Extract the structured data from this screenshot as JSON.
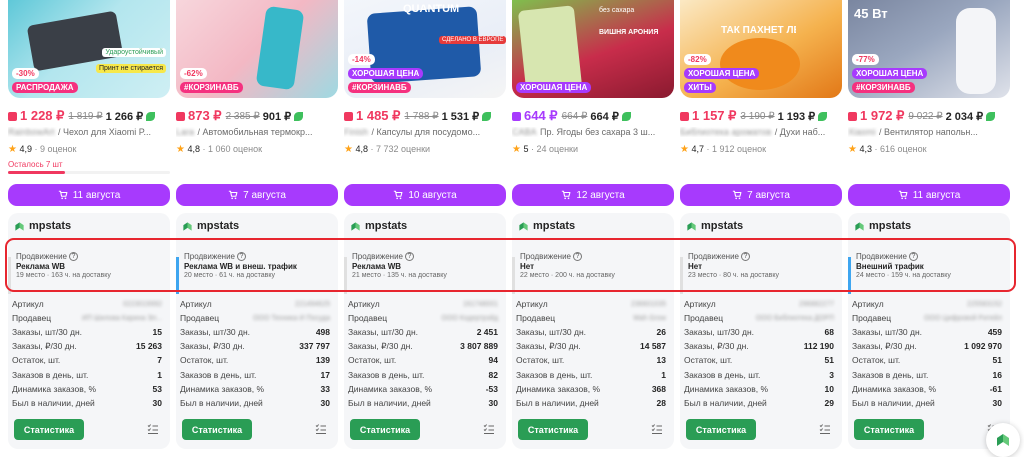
{
  "products": [
    {
      "image_badges": [
        "-30%",
        "РАСПРОДАЖА"
      ],
      "image_overlay": [
        "Удароустойчивый",
        "Принт не стирается"
      ],
      "price_now": "1 228 ₽",
      "price_old": "1 819 ₽",
      "price_wallet": "1 266 ₽",
      "brand": "RainbowArt",
      "title": "/ Чехол для Xiaomi P...",
      "rating": "4,9",
      "reviews": "· 9 оценок",
      "stock_left": "Осталось 7 шт",
      "delivery": "11 августа",
      "price_color": "#f0385f",
      "promo_label": "Продвижение",
      "promo_value": "Реклама WB",
      "promo_pos": "19 место · 163 ч. на доставку",
      "promo_bar_color": "#e0e0e0",
      "article": "0223019992",
      "seller": "ИП Шилова Карина Эл...",
      "stats": {
        "orders_qty": "15",
        "orders_rub": "15 263",
        "stock": "7",
        "orders_day": "1",
        "dyn": "53",
        "days": "30"
      }
    },
    {
      "image_badges": [
        "-62%",
        "#КОРЗИНАВБ"
      ],
      "image_overlay": [],
      "price_now": "873 ₽",
      "price_old": "2 385 ₽",
      "price_wallet": "901 ₽",
      "brand": "Lara",
      "title": "/ Автомобильная термокр...",
      "rating": "4,8",
      "reviews": "· 1 060 оценок",
      "stock_left": "",
      "delivery": "7 августа",
      "price_color": "#f0385f",
      "promo_label": "Продвижение",
      "promo_value": "Реклама WB и внеш. трафик",
      "promo_pos": "20 место · 61 ч. на доставку",
      "promo_bar_color": "#3fa6f0",
      "article": "221494625",
      "seller": "ООО Техника И Посуда",
      "stats": {
        "orders_qty": "498",
        "orders_rub": "337 797",
        "stock": "139",
        "orders_day": "17",
        "dyn": "33",
        "days": "30"
      }
    },
    {
      "image_badges": [
        "-14%",
        "ХОРОШАЯ ЦЕНА",
        "#КОРЗИНАВБ"
      ],
      "image_overlay": [
        "QUANTUM",
        "СДЕЛАНО В ЕВРОПЕ"
      ],
      "price_now": "1 485 ₽",
      "price_old": "1 788 ₽",
      "price_wallet": "1 531 ₽",
      "brand": "Finish",
      "title": "/ Капсулы для посудомо...",
      "rating": "4,8",
      "reviews": "· 7 732 оценки",
      "stock_left": "",
      "delivery": "10 августа",
      "price_color": "#f0385f",
      "promo_label": "Продвижение",
      "promo_value": "Реклама WB",
      "promo_pos": "21 место · 135 ч. на доставку",
      "promo_bar_color": "#e0e0e0",
      "article": "161748001",
      "seller": "ООО Кодертрэйд",
      "stats": {
        "orders_qty": "2 451",
        "orders_rub": "3 807 889",
        "stock": "94",
        "orders_day": "82",
        "dyn": "-53",
        "days": "30"
      }
    },
    {
      "image_badges": [
        "ХОРОШАЯ ЦЕНА"
      ],
      "image_overlay": [
        "без сахара",
        "ВИШНЯ АРОНИЯ"
      ],
      "price_now": "644 ₽",
      "price_old": "664 ₽",
      "price_wallet": "664 ₽",
      "brand": "CABA",
      "title": "Пр. Ягоды без сахара 3 ш...",
      "rating": "5",
      "reviews": "· 24 оценки",
      "stock_left": "",
      "delivery": "12 августа",
      "price_color": "#a73afd",
      "promo_label": "Продвижение",
      "promo_value": "Нет",
      "promo_pos": "22 место · 200 ч. на доставку",
      "promo_bar_color": "#e0e0e0",
      "article": "236601035",
      "seller": "Wah Grow",
      "stats": {
        "orders_qty": "26",
        "orders_rub": "14 587",
        "stock": "13",
        "orders_day": "1",
        "dyn": "368",
        "days": "28"
      }
    },
    {
      "image_badges": [
        "-82%",
        "ХОРОШАЯ ЦЕНА",
        "ХИТЫ"
      ],
      "image_overlay": [
        "ТАК ПАХНЕТ ЛЕТО"
      ],
      "price_now": "1 157 ₽",
      "price_old": "3 190 ₽",
      "price_wallet": "1 193 ₽",
      "brand": "Библиотека ароматов",
      "title": "/ Духи наб...",
      "rating": "4,7",
      "reviews": "· 1 912 оценок",
      "stock_left": "",
      "delivery": "7 августа",
      "price_color": "#f0385f",
      "promo_label": "Продвижение",
      "promo_value": "Нет",
      "promo_pos": "23 место · 80 ч. на доставку",
      "promo_bar_color": "#e0e0e0",
      "article": "296882277",
      "seller": "ООО Библиотека ДОРП",
      "stats": {
        "orders_qty": "68",
        "orders_rub": "112 190",
        "stock": "51",
        "orders_day": "3",
        "dyn": "10",
        "days": "29"
      }
    },
    {
      "image_badges": [
        "-77%",
        "ХОРОШАЯ ЦЕНА",
        "#КОРЗИНАВБ"
      ],
      "image_overlay": [
        "45 Вт"
      ],
      "price_now": "1 972 ₽",
      "price_old": "9 022 ₽",
      "price_wallet": "2 034 ₽",
      "brand": "Xiaomi",
      "title": "/ Вентилятор напольн...",
      "rating": "4,3",
      "reviews": "· 616 оценок",
      "stock_left": "",
      "delivery": "11 августа",
      "price_color": "#f0385f",
      "promo_label": "Продвижение",
      "promo_value": "Внешний трафик",
      "promo_pos": "24 место · 159 ч. на доставку",
      "promo_bar_color": "#3fa6f0",
      "article": "225583152",
      "seller": "ООО Цифровой Ритейл",
      "stats": {
        "orders_qty": "459",
        "orders_rub": "1 092 970",
        "stock": "51",
        "orders_day": "16",
        "dyn": "-61",
        "days": "30"
      }
    }
  ],
  "mpstats": {
    "title": "mpstats",
    "labels": {
      "article": "Артикул",
      "seller": "Продавец",
      "orders_qty": "Заказы, шт/30 дн.",
      "orders_rub": "Заказы, ₽/30 дн.",
      "stock": "Остаток, шт.",
      "orders_day": "Заказов в день, шт.",
      "dyn": "Динамика заказов, %",
      "days": "Был в наличии, дней"
    },
    "stat_button": "Статистика",
    "icons": [
      "list-check-icon",
      "help-circle-icon",
      "cart-icon",
      "mpstats-logo-icon"
    ],
    "accent": "#2a9d55",
    "highlight_color": "#e7262f"
  },
  "colors": {
    "purple": "#a73afd",
    "pink": "#f5317f",
    "red_price": "#f0385f"
  }
}
